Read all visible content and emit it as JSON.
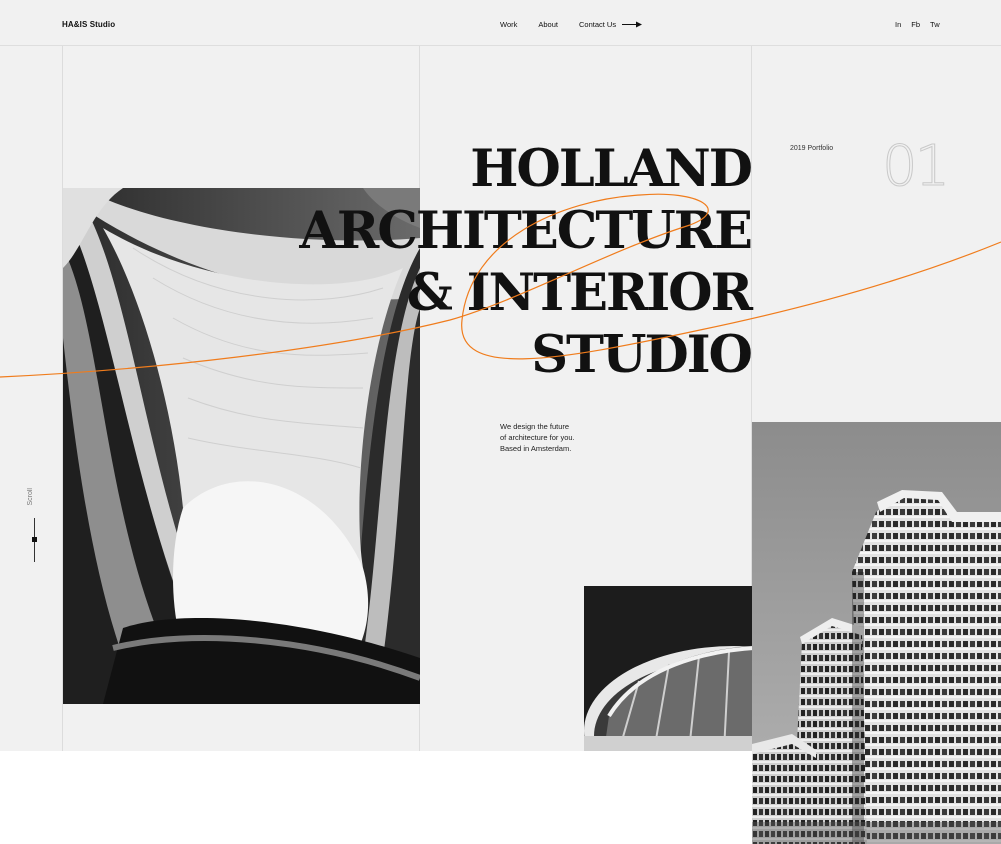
{
  "brand": {
    "logo": "HA&IS Studio"
  },
  "nav": {
    "work": "Work",
    "about": "About",
    "contact": "Contact Us"
  },
  "social": {
    "linkedin": "In",
    "facebook": "Fb",
    "twitter": "Tw"
  },
  "hero": {
    "line1": "HOLLAND",
    "line2": "ARCHITECTURE",
    "line3": "& INTERIOR",
    "line4": "STUDIO",
    "tagline_1": "We design the future",
    "tagline_2": "of architecture for you.",
    "tagline_3": "Based in Amsterdam."
  },
  "portfolio": {
    "label": "2019 Portfolio",
    "number": "01"
  },
  "scroll": {
    "label": "Scroll"
  },
  "colors": {
    "accent": "#f07c1c",
    "background": "#f1f1f1",
    "text": "#111111"
  }
}
